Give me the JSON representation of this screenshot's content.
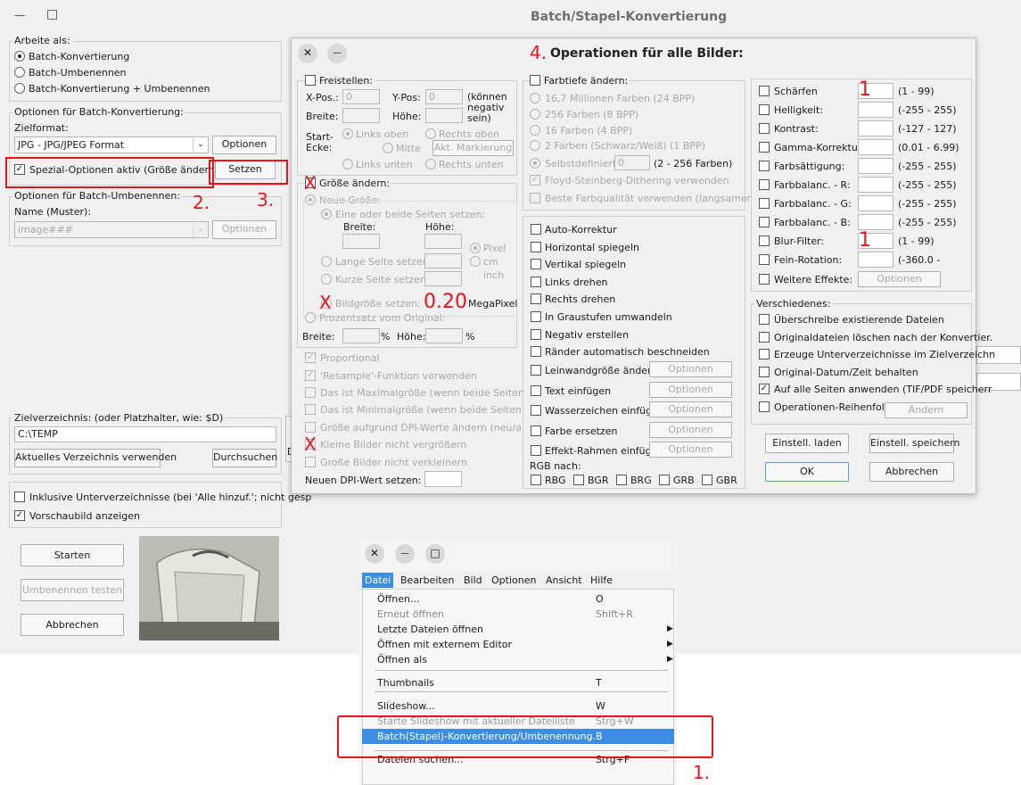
{
  "main_window": {
    "title": "Batch/Stapel-Konvertierung",
    "minimize_glyph": "—",
    "maximize_glyph": "□",
    "work_as": {
      "label": "Arbeite als:",
      "options": [
        "Batch-Konvertierung",
        "Batch-Umbenennen",
        "Batch-Konvertierung + Umbenennen"
      ]
    },
    "batch_options": {
      "label": "Optionen für Batch-Konvertierung:",
      "format_label": "Zielformat:",
      "format_value": "JPG - JPG/JPEG Format",
      "options_button": "Optionen",
      "special_checkbox": "Spezial-Optionen aktiv (Größe ändern etc)",
      "set_button": "Setzen"
    },
    "rename_options": {
      "label": "Optionen für Batch-Umbenennen:",
      "name_label": "Name (Muster):",
      "name_value": "image###",
      "options_button": "Optionen"
    },
    "target_dir": {
      "label": "Zielverzeichnis: (oder Platzhalter, wie: $D)",
      "value": "C:\\TEMP",
      "use_current_button": "Aktuelles Verzeichnis verwenden",
      "browse_button": "Durchsuchen"
    },
    "include_subdirs": "Inklusive Unterverzeichnisse (bei 'Alle hinzuf.'; nicht gesp",
    "show_preview": "Vorschaubild anzeigen",
    "start_button": "Starten",
    "test_rename_button": "Umbenennen testen",
    "cancel_button": "Abbrechen",
    "peek_letters": [
      "D",
      "D"
    ]
  },
  "ops_dialog": {
    "title": "Operationen für alle Bilder:",
    "close_glyph": "✕",
    "minimize_glyph": "—",
    "crop": {
      "label": "Freistellen:",
      "xpos": "X-Pos.:",
      "xpos_value": "0",
      "ypos": "Y-Pos:",
      "ypos_value": "0",
      "negative_note": "(können negativ sein)",
      "width": "Breite:",
      "height": "Höhe:",
      "start_corner": "Start-Ecke:",
      "corners": [
        "Links oben",
        "Rechts oben",
        "Mitte",
        "Links unten",
        "Rechts unten"
      ],
      "act_marking": "Akt. Markierung"
    },
    "resize": {
      "label": "Größe ändern:",
      "new_size": "Neue Größe:",
      "one_or_both": "Eine oder beide Seiten setzen:",
      "width": "Breite:",
      "height": "Höhe:",
      "units": [
        "Pixel",
        "cm",
        "inch"
      ],
      "long_side": "Lange Seite setzen:",
      "short_side": "Kurze Seite setzen:",
      "image_size": "Bildgröße setzen:",
      "megapixel_value": "0.20",
      "megapixel": "MegaPixel",
      "percent_label": "Prozentsatz vom Original:",
      "pct_width": "Breite:",
      "pct_height": "Höhe:",
      "pct": "%"
    },
    "resize_options": [
      "Proportional",
      "'Resample'-Funktion verwenden",
      "Das ist Maximalgröße (wenn beide Seiten akt",
      "Das ist Minimalgröße (wenn beide Seiten aktiv",
      "Größe aufgrund DPI-Werte ändern (neu/alt)",
      "Kleine Bilder nicht vergrößern",
      "Große Bilder nicht verkleinern"
    ],
    "new_dpi": "Neuen DPI-Wert setzen:",
    "color_depth": {
      "label": "Farbtiefe ändern:",
      "options": [
        "16,7 Millionen Farben (24 BPP)",
        "256 Farben (8 BPP)",
        "16 Farben (4 BPP)",
        "2 Farben (Schwarz/Weiß) (1 BPP)",
        "Selbstdefiniert:"
      ],
      "custom_value": "0",
      "custom_range": "(2 - 256 Farben)",
      "floyd": "Floyd-Steinberg-Dithering verwenden",
      "best_quality": "Beste Farbqualität verwenden (langsamer)"
    },
    "transforms": [
      "Auto-Korrektur",
      "Horizontal spiegeln",
      "Vertikal spiegeln",
      "Links drehen",
      "Rechts drehen",
      "In Graustufen umwandeln",
      "Negativ erstellen",
      "Ränder automatisch beschneiden"
    ],
    "with_options": [
      "Leinwandgröße ändern",
      "Text einfügen",
      "Wasserzeichen einfüg.",
      "Farbe ersetzen",
      "Effekt-Rahmen einfüg."
    ],
    "options_button": "Optionen",
    "rgb_label": "RGB nach:",
    "rgb_options": [
      "RBG",
      "BGR",
      "BRG",
      "GRB",
      "GBR"
    ],
    "adjust": [
      {
        "label": "Schärfen",
        "value": "1",
        "range": "(1  -  99)"
      },
      {
        "label": "Helligkeit:",
        "value": "",
        "range": "(-255  -  255)"
      },
      {
        "label": "Kontrast:",
        "value": "",
        "range": "(-127  -  127)"
      },
      {
        "label": "Gamma-Korrektur:",
        "value": "",
        "range": "(0.01  -  6.99)"
      },
      {
        "label": "Farbsättigung:",
        "value": "",
        "range": "(-255  -  255)"
      },
      {
        "label": "Farbbalanc. - R:",
        "value": "",
        "range": "(-255  -  255)"
      },
      {
        "label": "Farbbalanc. - G:",
        "value": "",
        "range": "(-255  -  255)"
      },
      {
        "label": "Farbbalanc. - B:",
        "value": "",
        "range": "(-255  -  255)"
      },
      {
        "label": "Blur-Filter:",
        "value": "1",
        "range": "(1  -  99)"
      },
      {
        "label": "Fein-Rotation:",
        "value": "",
        "range": "(-360.0  -"
      }
    ],
    "more_effects": "Weitere Effekte:",
    "more_effects_button": "Optionen",
    "misc": {
      "label": "Verschiedenes:",
      "options": [
        "Überschreibe existierende Dateien",
        "Originaldateien löschen nach der Konvertier.",
        "Erzeuge Unterverzeichnisse im Zielverzeichn",
        "Original-Datum/Zeit behalten",
        "Auf alle Seiten anwenden (TIF/PDF speicherr",
        "Operationen-Reihenfolge"
      ],
      "change_button": "Ändern"
    },
    "load_settings": "Einstell. laden",
    "save_settings": "Einstell. speichern",
    "ok": "OK",
    "cancel": "Abbrechen"
  },
  "menu_window": {
    "close_glyph": "✕",
    "minimize_glyph": "—",
    "maximize_glyph": "□",
    "menubar": [
      "Datei",
      "Bearbeiten",
      "Bild",
      "Optionen",
      "Ansicht",
      "Hilfe"
    ],
    "items": [
      {
        "label": "Öffnen...",
        "shortcut": "O"
      },
      {
        "label": "Erneut öffnen",
        "shortcut": "Shift+R"
      },
      {
        "label": "Letzte Dateien öffnen",
        "shortcut": ""
      },
      {
        "label": "Öffnen mit externem Editor",
        "shortcut": ""
      },
      {
        "label": "Öffnen als",
        "shortcut": ""
      },
      {
        "label": "Thumbnails",
        "shortcut": "T"
      },
      {
        "label": "Slideshow...",
        "shortcut": "W"
      },
      {
        "label": "Starte Slideshow mit aktueller Dateiliste",
        "shortcut": "Strg+W"
      },
      {
        "label": "Batch(Stapel)-Konvertierung/Umbenennung...",
        "shortcut": "B"
      },
      {
        "label": "Dateien suchen...",
        "shortcut": "Strg+F"
      }
    ],
    "submenu_arrow": "▶"
  },
  "annotations": {
    "step1": "1.",
    "step2": "2.",
    "step3": "3.",
    "step4": "4.",
    "value_one": "1",
    "cross": "X",
    "color": "#e8141b"
  }
}
